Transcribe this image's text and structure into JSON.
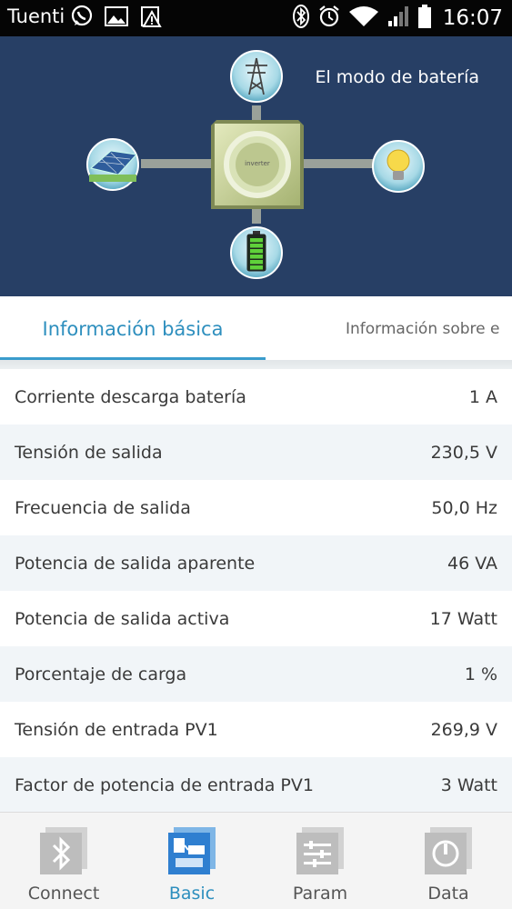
{
  "status_bar": {
    "carrier": "Tuenti",
    "time": "16:07",
    "icons": [
      "whatsapp-icon",
      "image-icon",
      "warning-icon",
      "bluetooth-icon",
      "alarm-icon",
      "wifi-icon",
      "signal-icon",
      "battery-icon"
    ]
  },
  "hero": {
    "mode": "El modo de batería",
    "inverter_label": "inverter",
    "battery_level": 1.0,
    "icons": [
      "solar-panel-icon",
      "grid-tower-icon",
      "light-bulb-icon",
      "battery-icon"
    ]
  },
  "tabs": [
    {
      "label": "Información básica",
      "selected": true
    },
    {
      "label": "Información sobre e",
      "selected": false
    }
  ],
  "rows": [
    {
      "label": "Corriente descarga batería",
      "value": "1 A"
    },
    {
      "label": "Tensión de salida",
      "value": "230,5 V"
    },
    {
      "label": "Frecuencia de salida",
      "value": "50,0 Hz"
    },
    {
      "label": "Potencia de salida aparente",
      "value": "46 VA"
    },
    {
      "label": "Potencia de salida activa",
      "value": "17 Watt"
    },
    {
      "label": "Porcentaje de carga",
      "value": "1 %"
    },
    {
      "label": "Tensión de entrada PV1",
      "value": "269,9 V"
    },
    {
      "label": "Factor de potencia de entrada PV1",
      "value": "3 Watt"
    }
  ],
  "bottom_nav": [
    {
      "label": "Connect",
      "icon": "bluetooth-icon",
      "active": false
    },
    {
      "label": "Basic",
      "icon": "basic-icon",
      "active": true
    },
    {
      "label": "Param",
      "icon": "settings-icon",
      "active": false
    },
    {
      "label": "Data",
      "icon": "data-icon",
      "active": false
    }
  ],
  "colors": {
    "accent": "#2e8fbe",
    "hero_bg": "#273f65",
    "inverter": "#c9d49a"
  }
}
